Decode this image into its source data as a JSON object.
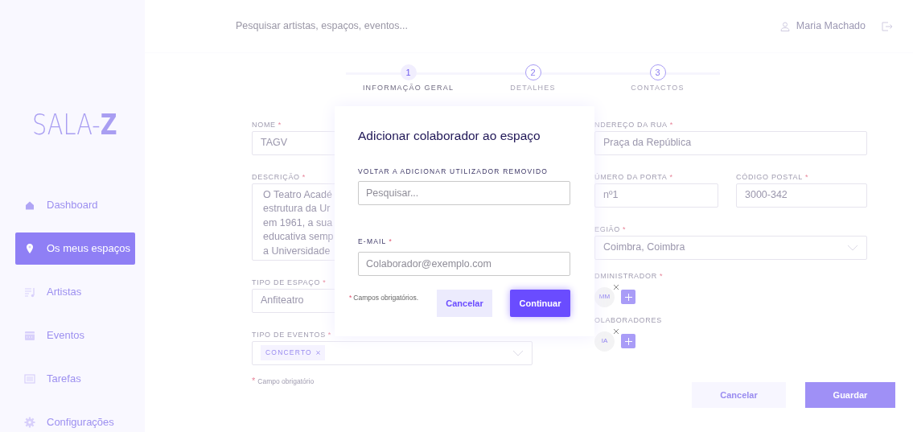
{
  "sidebar": {
    "logo": "SALA-**Z**",
    "items": [
      {
        "label": "Dashboard",
        "selected": false
      },
      {
        "label": "Os meus espaços",
        "selected": true
      },
      {
        "label": "Artistas",
        "selected": false
      },
      {
        "label": "Eventos",
        "selected": false
      },
      {
        "label": "Tarefas",
        "selected": false
      },
      {
        "label": "Configurações",
        "selected": false
      }
    ]
  },
  "topbar": {
    "search": {
      "placeholder": "Pesquisar artistas, espaços, eventos..."
    },
    "user": "Maria Machado"
  },
  "stepper": [
    {
      "number": "1",
      "label": "INFORMAÇÃO GERAL",
      "selected": true
    },
    {
      "number": "2",
      "label": "DETALHES",
      "selected": false
    },
    {
      "number": "3",
      "label": "CONTACTOS",
      "selected": false
    }
  ],
  "form": {
    "name": {
      "label": "NOME",
      "mark": "*",
      "value": "TAGV"
    },
    "description": {
      "label": "DESCRIÇÃO",
      "mark": "*",
      "lines": [
        "O Teatro Acadé",
        "estrutura da Ur",
        "em 1961, a sua",
        "educativa semp",
        "a Universidade"
      ]
    },
    "space_type": {
      "label": "TIPO DE ESPAÇO",
      "mark": "*",
      "value": "Anfiteatro"
    },
    "event_types": {
      "label": "TIPO DE EVENTOS",
      "mark": "*",
      "tags": [
        "CONCERTO"
      ]
    },
    "required_note": {
      "mark": "*",
      "text": "Campo obrigatório"
    },
    "street": {
      "label": "NDEREÇO DA RUA",
      "mark": "*",
      "value": "Praça da República"
    },
    "door": {
      "label": "ÚMERO DA PORTA",
      "mark": "*",
      "value": "nº1"
    },
    "postal": {
      "label": "CÓDIGO POSTAL",
      "mark": "*",
      "value": "3000-342"
    },
    "region": {
      "label": "EGIÃO",
      "mark": "*",
      "value": "Coimbra, Coimbra"
    },
    "admin": {
      "label": "DMINISTRADOR",
      "mark": "*",
      "people": [
        "MM"
      ]
    },
    "collaborators": {
      "label": "OLABORADORES",
      "people": [
        "IA"
      ]
    },
    "buttons": [
      "Cancelar",
      "Guardar"
    ]
  },
  "modal": {
    "title": "Adicionar colaborador ao espaço",
    "search_label": "VOLTAR A ADICIONAR UTILIZADOR REMOVIDO",
    "search_placeholder": "Pesquisar...",
    "email_label": "E-MAIL",
    "email_mark": "*",
    "email_placeholder": "Colaborador@exemplo.com",
    "note": {
      "mark": "*",
      "text": "Campos obrigatórios."
    },
    "buttons": [
      "Cancelar",
      "Continuar"
    ]
  }
}
